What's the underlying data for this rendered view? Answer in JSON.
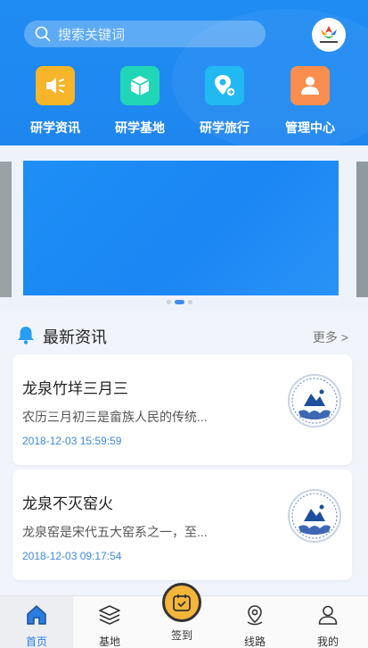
{
  "search": {
    "placeholder": "搜索关键词"
  },
  "quick_links": [
    {
      "label": "研学资讯",
      "icon": "megaphone-icon",
      "color": "#f7b529"
    },
    {
      "label": "研学基地",
      "icon": "cube-icon",
      "color": "#20d6b6"
    },
    {
      "label": "研学旅行",
      "icon": "map-pin-icon",
      "color": "#22b9f3"
    },
    {
      "label": "管理中心",
      "icon": "user-icon",
      "color": "#fa8e4f"
    }
  ],
  "news": {
    "title": "最新资讯",
    "more": "更多 >",
    "items": [
      {
        "title": "龙泉竹垟三月三",
        "desc": "农历三月初三是畲族人民的传统...",
        "time": "2018-12-03 15:59:59"
      },
      {
        "title": "龙泉不灭窑火",
        "desc": "龙泉窑是宋代五大窑系之一，至...",
        "time": "2018-12-03 09:17:54"
      }
    ]
  },
  "tabs": [
    {
      "label": "首页",
      "icon": "home-icon",
      "active": true
    },
    {
      "label": "基地",
      "icon": "layers-icon"
    },
    {
      "label": "签到",
      "icon": "calendar-check-icon"
    },
    {
      "label": "线路",
      "icon": "location-icon"
    },
    {
      "label": "我的",
      "icon": "person-icon"
    }
  ],
  "colors": {
    "primary": "#1f8cf3",
    "tab_active": "#2a7de1",
    "checkin": "#f3b53a"
  }
}
